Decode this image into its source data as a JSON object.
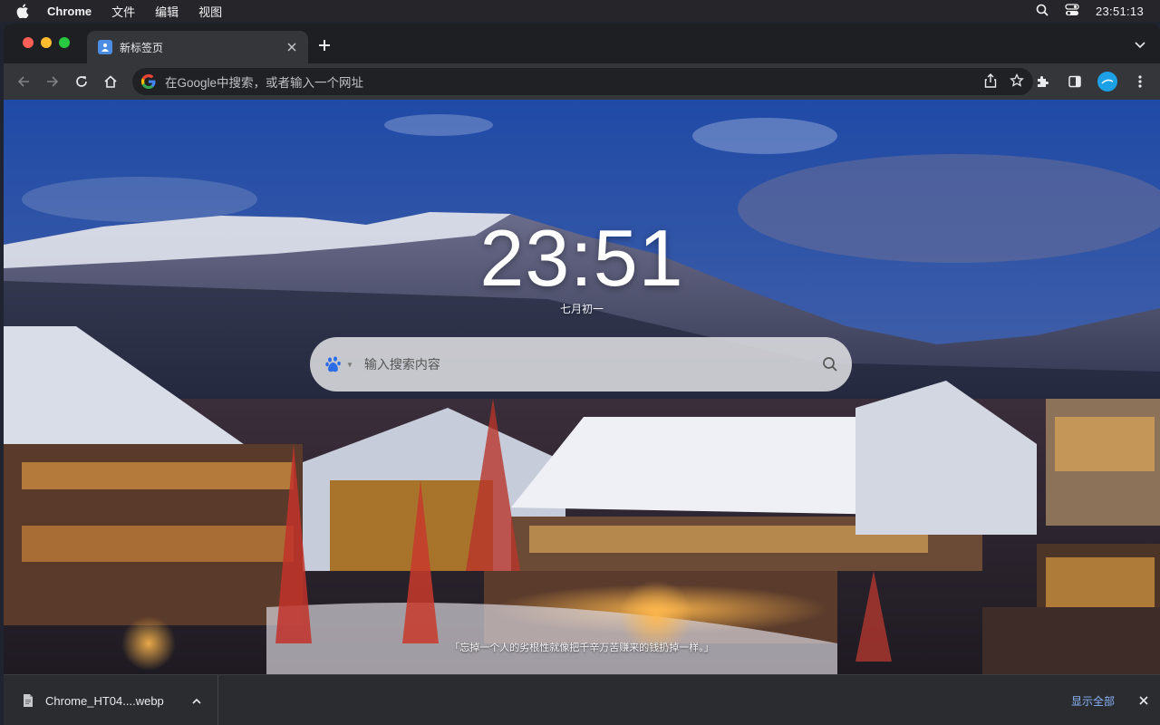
{
  "menubar": {
    "app_name": "Chrome",
    "items": [
      "文件",
      "编辑",
      "视图"
    ],
    "clock": "23:51:13"
  },
  "browser": {
    "tab_title": "新标签页",
    "omnibox_placeholder": "在Google中搜索，或者输入一个网址"
  },
  "page": {
    "time": "23:51",
    "lunar_date": "七月初一",
    "search_placeholder": "输入搜索内容",
    "quote": "「忘掉一个人的劣根性就像把千辛万苦赚来的钱扔掉一样。」"
  },
  "downloads": {
    "filename": "Chrome_HT04....webp",
    "show_all": "显示全部"
  },
  "colors": {
    "accent_link": "#8ab4f8",
    "traffic_red": "#ff5f57",
    "traffic_yellow": "#febc2e",
    "traffic_green": "#28c840"
  }
}
